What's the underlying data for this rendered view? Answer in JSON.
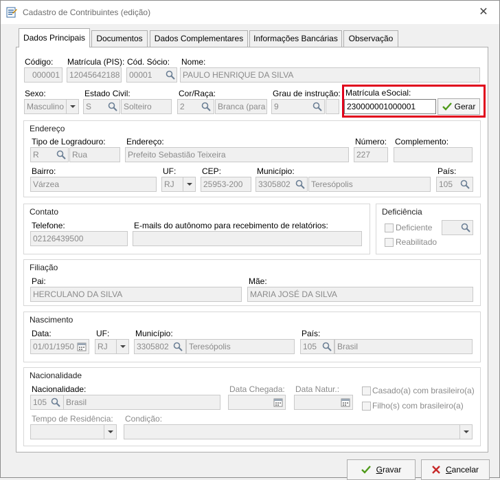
{
  "window": {
    "title": "Cadastro de Contribuintes (edição)",
    "close_glyph": "✕"
  },
  "tabs": [
    {
      "label": "Dados Principais",
      "active": true
    },
    {
      "label": "Documentos"
    },
    {
      "label": "Dados Complementares"
    },
    {
      "label": "Informações Bancárias"
    },
    {
      "label": "Observação"
    }
  ],
  "main": {
    "codigo": {
      "label": "Código:",
      "value": "000001"
    },
    "matricula_pis": {
      "label": "Matrícula (PIS):",
      "value": "12045642188"
    },
    "cod_socio": {
      "label": "Cód. Sócio:",
      "value": "00001"
    },
    "nome": {
      "label": "Nome:",
      "value": "PAULO HENRIQUE DA SILVA"
    },
    "sexo": {
      "label": "Sexo:",
      "value": "Masculino"
    },
    "estado_civil": {
      "label": "Estado Civil:",
      "code": "S",
      "value": "Solteiro"
    },
    "cor_raca": {
      "label": "Cor/Raça:",
      "code": "2",
      "value": "Branca (para a"
    },
    "grau_instrucao": {
      "label": "Grau de instrução:",
      "code": "9"
    },
    "matricula_esocial": {
      "label": "Matrícula eSocial:",
      "value": "230000001000001",
      "button": "Gerar"
    }
  },
  "endereco": {
    "title": "Endereço",
    "tipo_logradouro": {
      "label": "Tipo de Logradouro:",
      "code": "R",
      "value": "Rua"
    },
    "endereco": {
      "label": "Endereço:",
      "value": "Prefeito Sebastião Teixeira"
    },
    "numero": {
      "label": "Número:",
      "value": "227"
    },
    "complemento": {
      "label": "Complemento:",
      "value": ""
    },
    "bairro": {
      "label": "Bairro:",
      "value": "Várzea"
    },
    "uf": {
      "label": "UF:",
      "value": "RJ"
    },
    "cep": {
      "label": "CEP:",
      "value": "25953-200"
    },
    "municipio": {
      "label": "Município:",
      "code": "3305802",
      "value": "Teresópolis"
    },
    "pais": {
      "label": "País:",
      "code": "105"
    }
  },
  "contato": {
    "title": "Contato",
    "telefone": {
      "label": "Telefone:",
      "value": "02126439500"
    },
    "emails": {
      "label": "E-mails do autônomo para recebimento de relatórios:",
      "value": ""
    }
  },
  "deficiencia": {
    "title": "Deficiência",
    "deficiente": "Deficiente",
    "reabilitado": "Reabilitado"
  },
  "filiacao": {
    "title": "Filiação",
    "pai": {
      "label": "Pai:",
      "value": "HERCULANO DA SILVA"
    },
    "mae": {
      "label": "Mãe:",
      "value": "MARIA JOSÉ DA SILVA"
    }
  },
  "nascimento": {
    "title": "Nascimento",
    "data": {
      "label": "Data:",
      "value": "01/01/1950"
    },
    "uf": {
      "label": "UF:",
      "value": "RJ"
    },
    "municipio": {
      "label": "Município:",
      "code": "3305802",
      "value": "Teresópolis"
    },
    "pais": {
      "label": "País:",
      "code": "105",
      "value": "Brasil"
    }
  },
  "nacionalidade": {
    "title": "Nacionalidade",
    "nacionalidade": {
      "label": "Nacionalidade:",
      "code": "105",
      "value": "Brasil"
    },
    "data_chegada": {
      "label": "Data Chegada:",
      "value": ""
    },
    "data_natur": {
      "label": "Data Natur.:",
      "value": ""
    },
    "casado": "Casado(a) com brasileiro(a)",
    "filho": "Filho(s) com brasileiro(a)",
    "tempo_residencia": {
      "label": "Tempo de Residência:",
      "value": ""
    },
    "condicao": {
      "label": "Condição:",
      "value": ""
    }
  },
  "footer": {
    "gravar": {
      "accel": "G",
      "rest": "ravar"
    },
    "cancelar": {
      "accel": "C",
      "rest": "ancelar"
    }
  }
}
